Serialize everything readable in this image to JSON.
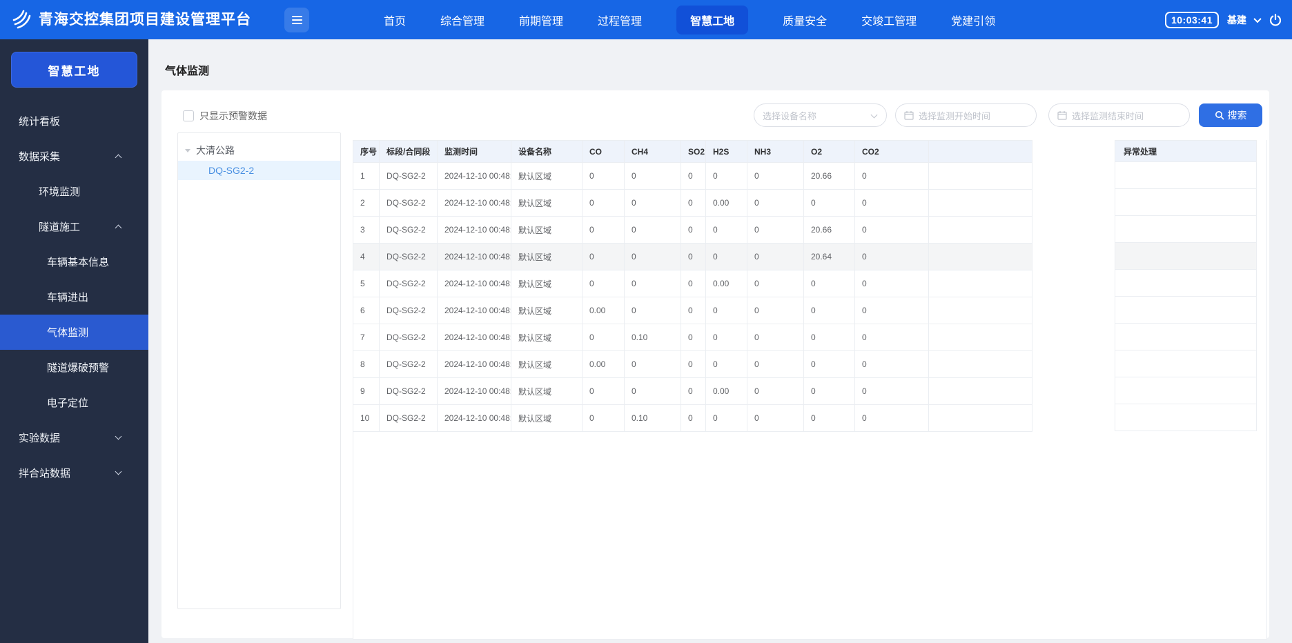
{
  "header": {
    "title": "青海交控集团项目建设管理平台",
    "time": "10:03:41",
    "user": "基建",
    "nav": [
      {
        "label": "首页",
        "active": false
      },
      {
        "label": "综合管理",
        "active": false
      },
      {
        "label": "前期管理",
        "active": false
      },
      {
        "label": "过程管理",
        "active": false
      },
      {
        "label": "智慧工地",
        "active": true
      },
      {
        "label": "质量安全",
        "active": false
      },
      {
        "label": "交竣工管理",
        "active": false
      },
      {
        "label": "党建引领",
        "active": false
      }
    ]
  },
  "sidebar": {
    "section_button": "智慧工地",
    "items": [
      {
        "label": "统计看板",
        "level": 0,
        "chevron": "",
        "active": false
      },
      {
        "label": "数据采集",
        "level": 0,
        "chevron": "up",
        "active": false
      },
      {
        "label": "环境监测",
        "level": 1,
        "chevron": "",
        "active": false
      },
      {
        "label": "隧道施工",
        "level": 1,
        "chevron": "up",
        "active": false
      },
      {
        "label": "车辆基本信息",
        "level": 2,
        "chevron": "",
        "active": false
      },
      {
        "label": "车辆进出",
        "level": 2,
        "chevron": "",
        "active": false
      },
      {
        "label": "气体监测",
        "level": 2,
        "chevron": "",
        "active": true
      },
      {
        "label": "隧道爆破预警",
        "level": 2,
        "chevron": "",
        "active": false
      },
      {
        "label": "电子定位",
        "level": 2,
        "chevron": "",
        "active": false
      },
      {
        "label": "实验数据",
        "level": 0,
        "chevron": "down",
        "active": false
      },
      {
        "label": "拌合站数据",
        "level": 0,
        "chevron": "down",
        "active": false
      }
    ]
  },
  "page": {
    "title": "气体监测",
    "filter_checkbox_label": "只显示预警数据",
    "device_select_placeholder": "选择设备名称",
    "start_time_placeholder": "选择监测开始时间",
    "end_time_placeholder": "选择监测结束时间",
    "search_label": "搜索"
  },
  "tree": {
    "root": "大清公路",
    "selected_child": "DQ-SG2-2"
  },
  "table": {
    "columns": [
      "序号",
      "标段/合同段",
      "监测时间",
      "设备名称",
      "CO",
      "CH4",
      "SO2",
      "H2S",
      "NH3",
      "O2",
      "CO2",
      ""
    ],
    "fixed_column": "异常处理",
    "highlighted_row_index": 3,
    "rows": [
      [
        "1",
        "DQ-SG2-2",
        "2024-12-10 00:48:…",
        "默认区域",
        "0",
        "0",
        "0",
        "0",
        "0",
        "20.66",
        "0",
        ""
      ],
      [
        "2",
        "DQ-SG2-2",
        "2024-12-10 00:48:…",
        "默认区域",
        "0",
        "0",
        "0",
        "0.00",
        "0",
        "0",
        "0",
        ""
      ],
      [
        "3",
        "DQ-SG2-2",
        "2024-12-10 00:48:…",
        "默认区域",
        "0",
        "0",
        "0",
        "0",
        "0",
        "20.66",
        "0",
        ""
      ],
      [
        "4",
        "DQ-SG2-2",
        "2024-12-10 00:48:…",
        "默认区域",
        "0",
        "0",
        "0",
        "0",
        "0",
        "20.64",
        "0",
        ""
      ],
      [
        "5",
        "DQ-SG2-2",
        "2024-12-10 00:48:…",
        "默认区域",
        "0",
        "0",
        "0",
        "0.00",
        "0",
        "0",
        "0",
        ""
      ],
      [
        "6",
        "DQ-SG2-2",
        "2024-12-10 00:48:…",
        "默认区域",
        "0.00",
        "0",
        "0",
        "0",
        "0",
        "0",
        "0",
        ""
      ],
      [
        "7",
        "DQ-SG2-2",
        "2024-12-10 00:48:…",
        "默认区域",
        "0",
        "0.10",
        "0",
        "0",
        "0",
        "0",
        "0",
        ""
      ],
      [
        "8",
        "DQ-SG2-2",
        "2024-12-10 00:48:…",
        "默认区域",
        "0.00",
        "0",
        "0",
        "0",
        "0",
        "0",
        "0",
        ""
      ],
      [
        "9",
        "DQ-SG2-2",
        "2024-12-10 00:48:…",
        "默认区域",
        "0",
        "0",
        "0",
        "0.00",
        "0",
        "0",
        "0",
        ""
      ],
      [
        "10",
        "DQ-SG2-2",
        "2024-12-10 00:48:…",
        "默认区域",
        "0",
        "0.10",
        "0",
        "0",
        "0",
        "0",
        "0",
        ""
      ]
    ]
  },
  "colors": {
    "header_blue": "#1766e5",
    "nav_active_blue": "#1150d8",
    "sidebar_bg": "#242e44",
    "sidebar_active_blue": "#2a5ad0",
    "section_button_blue": "#2456d8",
    "search_button_blue": "#2f6fe4",
    "tree_selected_bg": "#e9f4fe",
    "tree_selected_text": "#4a90e2",
    "table_header_bg": "#eef3fb",
    "row_highlight": "#f4f5f6"
  }
}
